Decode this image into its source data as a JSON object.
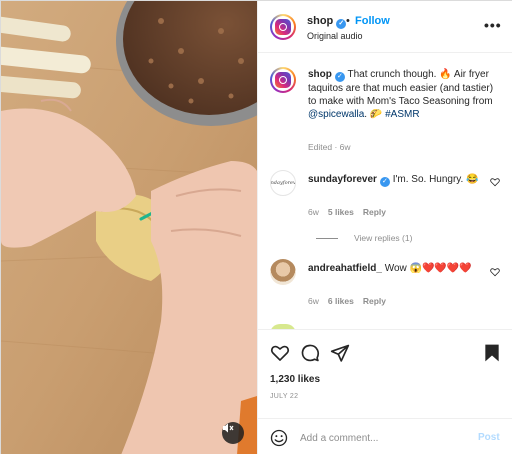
{
  "post": {
    "username": "shop",
    "separator": "•",
    "follow_label": "Follow",
    "audio_label": "Original audio",
    "more_label": "•••"
  },
  "caption": {
    "username": "shop",
    "text_before_mention": "That crunch though. 🔥 Air fryer taquitos are that much easier (and tastier) to make with Mom's Taco Seasoning from ",
    "mention": "@spicewalla",
    "text_after_mention": ". 🌮 ",
    "hashtag": "#ASMR",
    "meta": "Edited · 6w"
  },
  "comments": [
    {
      "username": "sundayforever",
      "avatar_text": "sundayforever",
      "text": "I'm. So. Hungry. 😂",
      "age": "6w",
      "likes": "5 likes",
      "reply_label": "Reply",
      "view_replies": "View replies (1)"
    },
    {
      "username": "andreahatfield_",
      "text": "Wow 😱❤️❤️❤️❤️",
      "age": "6w",
      "likes": "6 likes",
      "reply_label": "Reply"
    }
  ],
  "actions": {
    "likes_count": "1,230 likes",
    "date": "JULY 22"
  },
  "add_comment": {
    "placeholder": "Add a comment...",
    "post_label": "Post"
  },
  "colors": {
    "accent": "#0095f6",
    "post_disabled": "#b3dbff",
    "verified": "#3897f0"
  }
}
